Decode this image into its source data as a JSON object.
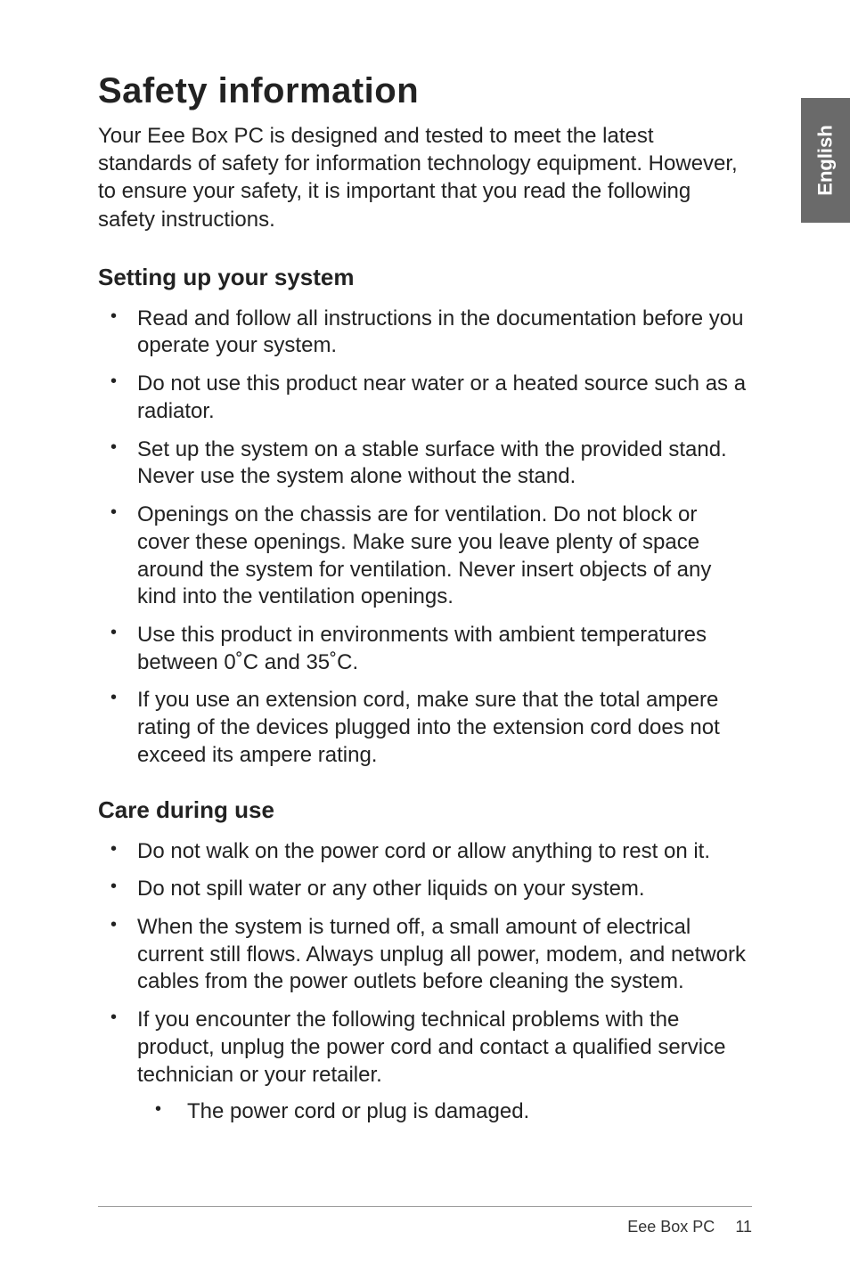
{
  "sideTab": "English",
  "title": "Safety information",
  "intro": "Your Eee Box PC is designed and tested to meet the latest standards of safety for information technology equipment. However, to ensure your safety, it is important that you read the following safety instructions.",
  "section1": {
    "heading": "Setting up your system",
    "items": [
      "Read and follow all instructions in the documentation before you operate your system.",
      "Do not use this product near water or a heated source such as a radiator.",
      "Set up the system on a stable surface with the provided stand. Never use the system alone without the stand.",
      "Openings on the chassis are for ventilation. Do not block or cover these openings. Make sure you leave plenty of space around the system for ventilation. Never insert objects of any kind into the ventilation openings.",
      "Use this product in environments with ambient temperatures between 0˚C and 35˚C.",
      "If you use an extension cord, make sure that the total ampere rating of the devices plugged into the extension cord does not exceed its ampere rating."
    ]
  },
  "section2": {
    "heading": "Care during use",
    "items": [
      "Do not walk on the power cord or allow anything to rest on it.",
      "Do not spill water or any other liquids on your system.",
      "When the system is turned off, a small amount of electrical current still flows. Always unplug all power, modem, and network cables from the power outlets before cleaning the system.",
      "If you encounter the following technical problems with the product, unplug the power cord and contact a qualified service technician or your retailer."
    ],
    "subItems": [
      "The power cord or plug is damaged."
    ]
  },
  "footer": {
    "label": "Eee Box PC",
    "page": "11"
  }
}
